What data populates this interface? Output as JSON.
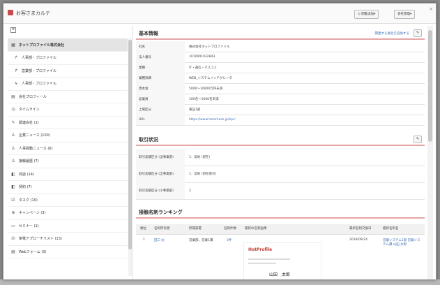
{
  "modal": {
    "title": "お客さまカルテ",
    "buttons": [
      "⊙ 閲覧追加▾",
      "会社管理▾"
    ],
    "close": "×"
  },
  "sidebar": {
    "collapse": "≡",
    "items": [
      {
        "icon": "building-icon",
        "glyph": "▦",
        "label": "ホットプロファイル株式会社",
        "active": true,
        "sub": false
      },
      {
        "icon": "arrow-icon",
        "glyph": "↱",
        "label": "人事部・プロファイル",
        "active": false,
        "sub": true
      },
      {
        "icon": "arrow-icon",
        "glyph": "↱",
        "label": "営業部・プロファイル",
        "active": false,
        "sub": true
      },
      {
        "icon": "arrow-icon",
        "glyph": "↳",
        "label": "人事部・プロファイル",
        "active": false,
        "sub": true
      },
      {
        "icon": "company-profile-icon",
        "glyph": "▤",
        "label": "会社プロフィール",
        "active": false,
        "sub": false
      },
      {
        "icon": "timeline-icon",
        "glyph": "◷",
        "label": "タイムライン",
        "active": false,
        "sub": false
      },
      {
        "icon": "note-icon",
        "glyph": "✎",
        "label": "関連会社 (1)",
        "active": false,
        "sub": false
      },
      {
        "icon": "news-icon",
        "glyph": "♙",
        "label": "企業ニュース (100)",
        "active": false,
        "sub": false
      },
      {
        "icon": "hr-news-icon",
        "glyph": "♙",
        "label": "人事異動ニュース (6)",
        "active": false,
        "sub": false
      },
      {
        "icon": "history-icon",
        "glyph": "♙",
        "label": "接触履歴 (7)",
        "active": false,
        "sub": false
      },
      {
        "icon": "deal-icon",
        "glyph": "◧",
        "label": "商談 (14)",
        "active": false,
        "sub": false
      },
      {
        "icon": "contract-icon",
        "glyph": "◧",
        "label": "契約 (7)",
        "active": false,
        "sub": false
      },
      {
        "icon": "task-icon",
        "glyph": "☑",
        "label": "タスク (10)",
        "active": false,
        "sub": false
      },
      {
        "icon": "campaign-icon",
        "glyph": "⊕",
        "label": "キャンペーン (3)",
        "active": false,
        "sub": false
      },
      {
        "icon": "seminar-icon",
        "glyph": "▭",
        "label": "セミナー (1)",
        "active": false,
        "sub": false
      },
      {
        "icon": "call-icon",
        "glyph": "☏",
        "label": "架電アプローチリスト (13)",
        "active": false,
        "sub": false
      },
      {
        "icon": "web-form-icon",
        "glyph": "▤",
        "label": "Webフォーム (3)",
        "active": false,
        "sub": false
      }
    ]
  },
  "basic": {
    "title": "基本情報",
    "link": "関連する会社を追加する",
    "rows": [
      {
        "k": "社名",
        "v": "株式会社ホットプロファイル",
        "link": false
      },
      {
        "k": "法人番号",
        "v": "1010001032843",
        "link": false
      },
      {
        "k": "業種",
        "v": "IT・通信・マスコミ",
        "link": false
      },
      {
        "k": "業種詳細",
        "v": "WEB_システムインテグレータ",
        "link": false
      },
      {
        "k": "資本金",
        "v": "5000～10000万円未満",
        "link": false
      },
      {
        "k": "従業員",
        "v": "100名～1000名未満",
        "link": false
      },
      {
        "k": "上場区分",
        "v": "東証1部",
        "link": false
      },
      {
        "k": "URL",
        "v": "https://www.hammock.jp/hpr/",
        "link": true
      }
    ]
  },
  "trade": {
    "title": "取引状況",
    "rows": [
      {
        "k": "取引実績区分 (当事業部)",
        "v": "1：契約 (現在)"
      },
      {
        "k": "取引実績区分 (全事業部)",
        "v": "1：契約 (現在取引)"
      },
      {
        "k": "取引実績区分 (小事業部)",
        "v": "2"
      }
    ]
  },
  "ranking": {
    "title": "接触名刺ランキング",
    "headers": [
      "順位",
      "名刺所有者",
      "所属部署",
      "名刺件数",
      "最新の名刺画像",
      "最新名刺交換日",
      "最新名刺名"
    ],
    "row": {
      "rank": "1",
      "owner": "田口 太",
      "dept": "営業部、営業1課",
      "count": "3件",
      "card_brand": "HotProfile",
      "card_name": "山田　太郎",
      "date": "2019/09/24",
      "latest": "営業システム1部 営業システム課 山田 太郎"
    }
  }
}
